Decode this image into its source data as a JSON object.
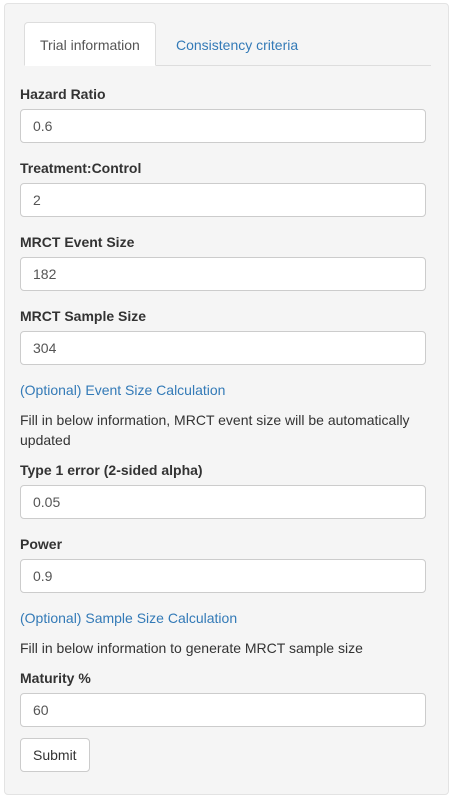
{
  "tabs": [
    {
      "label": "Trial information",
      "active": true
    },
    {
      "label": "Consistency criteria",
      "active": false
    }
  ],
  "fields": {
    "hazard_ratio": {
      "label": "Hazard Ratio",
      "value": "0.6"
    },
    "treatment_control": {
      "label": "Treatment:Control",
      "value": "2"
    },
    "event_size": {
      "label": "MRCT Event Size",
      "value": "182"
    },
    "sample_size": {
      "label": "MRCT Sample Size",
      "value": "304"
    },
    "alpha": {
      "label": "Type 1 error (2-sided alpha)",
      "value": "0.05"
    },
    "power": {
      "label": "Power",
      "value": "0.9"
    },
    "maturity": {
      "label": "Maturity %",
      "value": "60"
    }
  },
  "event_section": {
    "link": "(Optional) Event Size Calculation",
    "help": "Fill in below information, MRCT event size will be automatically updated"
  },
  "sample_section": {
    "link": "(Optional) Sample Size Calculation",
    "help": "Fill in below information to generate MRCT sample size"
  },
  "submit_label": "Submit",
  "colors": {
    "link": "#337ab7",
    "panel_bg": "#f5f5f5",
    "border": "#cccccc"
  }
}
